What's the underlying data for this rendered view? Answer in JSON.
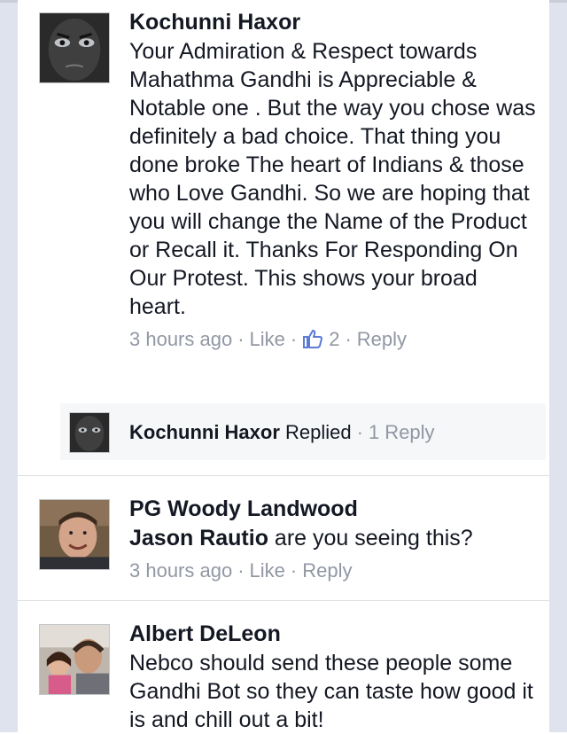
{
  "comments": [
    {
      "author": "Kochunni Haxor",
      "text": "Your Admiration & Respect towards Mahathma Gandhi is Appreciable & Notable one . But the way you chose was definitely a bad choice. That thing you done broke The heart of Indians & those who Love Gandhi. So we are hoping that you will change the Name of the Product or Recall it. Thanks For Responding On Our Protest. This shows your broad heart.",
      "time": "3 hours ago",
      "like_label": "Like",
      "like_count": "2",
      "reply_label": "Reply",
      "avatar_icon": "dark-face-avatar"
    },
    {
      "author": "PG Woody Landwood",
      "mention": "Jason Rautio",
      "text": " are you seeing this?",
      "time": "3 hours ago",
      "like_label": "Like",
      "reply_label": "Reply",
      "avatar_icon": "smiling-man-avatar"
    },
    {
      "author": "Albert DeLeon",
      "text": "Nebco should send these people some Gandhi Bot so they can taste how good it is and chill out a bit!",
      "avatar_icon": "man-with-child-avatar"
    }
  ],
  "reply_summary": {
    "author": "Kochunni Haxor",
    "action": " Replied",
    "count_text": "1 Reply"
  },
  "separator": "·",
  "colors": {
    "text": "#141823",
    "meta": "#9197a3",
    "like_blue": "#5b7bd5",
    "page_side": "#dfe3ee"
  }
}
